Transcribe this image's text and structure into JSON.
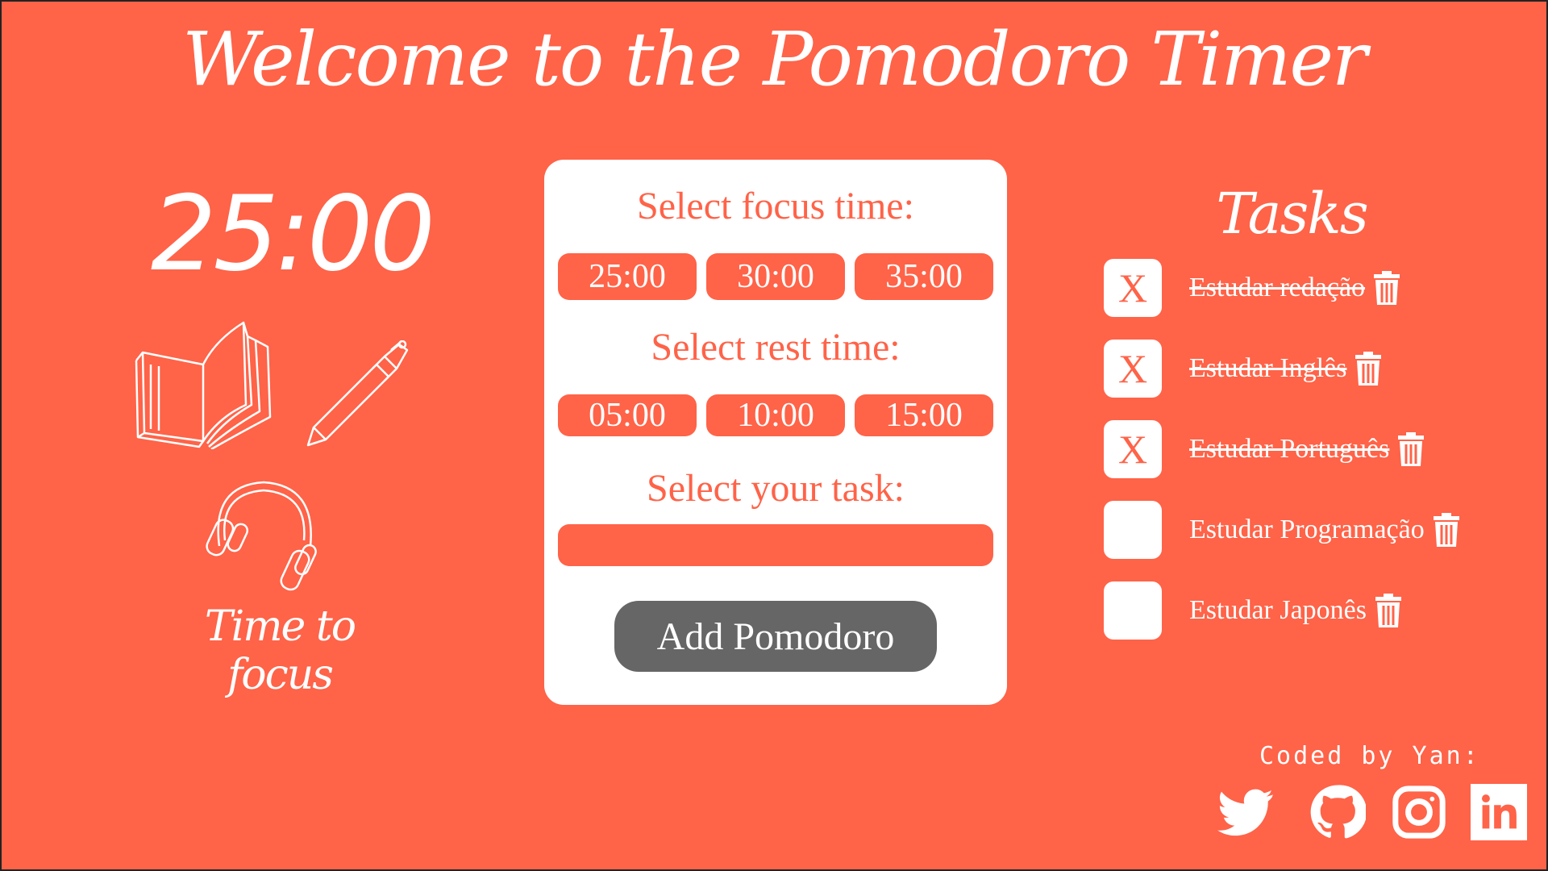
{
  "header": {
    "title": "Welcome to the Pomodoro Timer"
  },
  "timer": {
    "display": "25:00",
    "caption": "Time to focus"
  },
  "config": {
    "focus_heading": "Select focus time:",
    "focus_options": [
      "25:00",
      "30:00",
      "35:00"
    ],
    "rest_heading": "Select rest time:",
    "rest_options": [
      "05:00",
      "10:00",
      "15:00"
    ],
    "task_heading": "Select your task:",
    "task_value": "",
    "add_button": "Add Pomodoro"
  },
  "tasks": {
    "title": "Tasks",
    "items": [
      {
        "label": "Estudar redação",
        "done": true,
        "mark": "X"
      },
      {
        "label": "Estudar Inglês",
        "done": true,
        "mark": "X"
      },
      {
        "label": "Estudar Português",
        "done": true,
        "mark": "X"
      },
      {
        "label": "Estudar Programação",
        "done": false,
        "mark": ""
      },
      {
        "label": "Estudar Japonês",
        "done": false,
        "mark": ""
      }
    ]
  },
  "footer": {
    "credit": "Coded by Yan:",
    "socials": [
      "twitter-icon",
      "github-icon",
      "instagram-icon",
      "linkedin-icon"
    ]
  },
  "colors": {
    "background": "#ff6348",
    "card": "#ffffff",
    "button_dark": "#666666",
    "text": "#ffffff"
  }
}
